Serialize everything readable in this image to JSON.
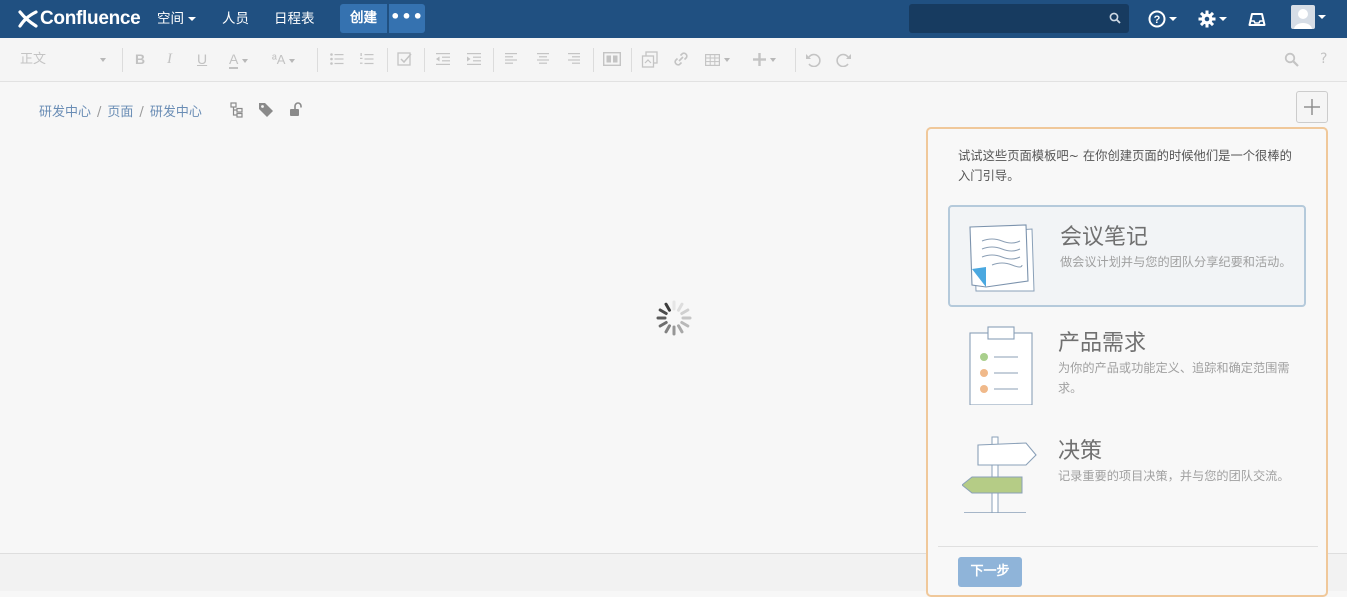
{
  "header": {
    "logo_text": "Confluence",
    "nav": {
      "spaces": "空间",
      "people": "人员",
      "calendar": "日程表"
    },
    "create_label": "创建",
    "more_label": "•••",
    "search_placeholder": "",
    "help_icon": "help-icon",
    "settings_icon": "gear-icon",
    "notifications_icon": "inbox-icon",
    "user_icon": "avatar",
    "brand_color": "#205081",
    "accent_color": "#3572b0"
  },
  "toolbar": {
    "paragraph_style": "正文",
    "bold": "B",
    "italic": "I",
    "underline": "U",
    "text_color": "A",
    "format_more": "ªA"
  },
  "breadcrumb": {
    "items": [
      "研发中心",
      "页面",
      "研发中心"
    ],
    "separator": "/"
  },
  "template_panel": {
    "intro": "试试这些页面模板吧~ 在你创建页面的时候他们是一个很棒的入门引导。",
    "border_color": "#f0c89a",
    "templates": [
      {
        "title": "会议笔记",
        "description": "做会议计划并与您的团队分享纪要和活动。",
        "selected": true,
        "icon": "meeting-notes-icon"
      },
      {
        "title": "产品需求",
        "description": "为你的产品或功能定义、追踪和确定范围需求。",
        "selected": false,
        "icon": "clipboard-icon"
      },
      {
        "title": "决策",
        "description": "记录重要的项目决策，并与您的团队交流。",
        "selected": false,
        "icon": "signpost-icon"
      }
    ],
    "next_label": "下一步"
  }
}
